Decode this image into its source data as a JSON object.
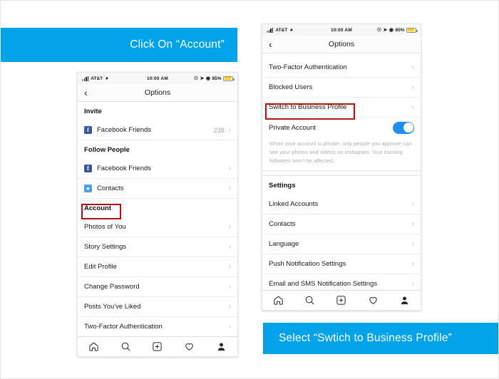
{
  "banners": {
    "left": "Click On “Account”",
    "right": "Select “Swtich to Business Profile”",
    "color": "#00a2e8"
  },
  "status_bar": {
    "carrier": "AT&T",
    "time": "10:00 AM",
    "battery_percent": "85%",
    "signal_icon": "signal-bars-icon",
    "wifi_icon": "wifi-icon",
    "location_icon": "location-arrow-icon",
    "alarm_icon": "alarm-icon",
    "lock_icon": "rotation-lock-icon",
    "battery_icon": "battery-icon"
  },
  "phone_left": {
    "nav": {
      "back_icon": "chevron-left-icon",
      "title": "Options"
    },
    "sections": [
      {
        "header": "Invite",
        "rows": [
          {
            "label": "Facebook Friends",
            "icon": "facebook-icon",
            "count": "238",
            "chevron": "›"
          }
        ]
      },
      {
        "header": "Follow People",
        "rows": [
          {
            "label": "Facebook Friends",
            "icon": "facebook-icon",
            "count": "",
            "chevron": "›"
          },
          {
            "label": "Contacts",
            "icon": "contacts-icon",
            "count": "",
            "chevron": "›"
          }
        ]
      },
      {
        "header": "Account",
        "rows": [
          {
            "label": "Photos of You",
            "icon": "",
            "count": "",
            "chevron": "›"
          },
          {
            "label": "Story Settings",
            "icon": "",
            "count": "",
            "chevron": "›"
          },
          {
            "label": "Edit Profile",
            "icon": "",
            "count": "",
            "chevron": "›"
          },
          {
            "label": "Change Password",
            "icon": "",
            "count": "",
            "chevron": "›"
          },
          {
            "label": "Posts You've Liked",
            "icon": "",
            "count": "",
            "chevron": "›"
          },
          {
            "label": "Two-Factor Authentication",
            "icon": "",
            "count": "",
            "chevron": "›"
          }
        ]
      }
    ],
    "highlight": "Account"
  },
  "phone_right": {
    "nav": {
      "back_icon": "chevron-left-icon",
      "title": "Options"
    },
    "rows_top": [
      {
        "label": "Two-Factor Authentication",
        "chevron": "›"
      },
      {
        "label": "Blocked Users",
        "chevron": "›"
      },
      {
        "label": "Switch to Business Profile",
        "chevron": "›"
      }
    ],
    "private_account": {
      "label": "Private Account",
      "toggle_state": "on",
      "description": "When your account is private, only people you approve can see your photos and videos on Instagram. Your existing followers won't be affected."
    },
    "settings_header": "Settings",
    "rows_bottom": [
      {
        "label": "Linked Accounts",
        "chevron": "›"
      },
      {
        "label": "Contacts",
        "chevron": "›"
      },
      {
        "label": "Language",
        "chevron": "›"
      },
      {
        "label": "Push Notification Settings",
        "chevron": "›"
      },
      {
        "label": "Email and SMS Notification Settings",
        "chevron": "›"
      }
    ],
    "highlight": "Switch to Business Profile"
  },
  "tab_bar": {
    "items": [
      "home-icon",
      "search-icon",
      "add-post-icon",
      "activity-heart-icon",
      "profile-icon"
    ]
  }
}
